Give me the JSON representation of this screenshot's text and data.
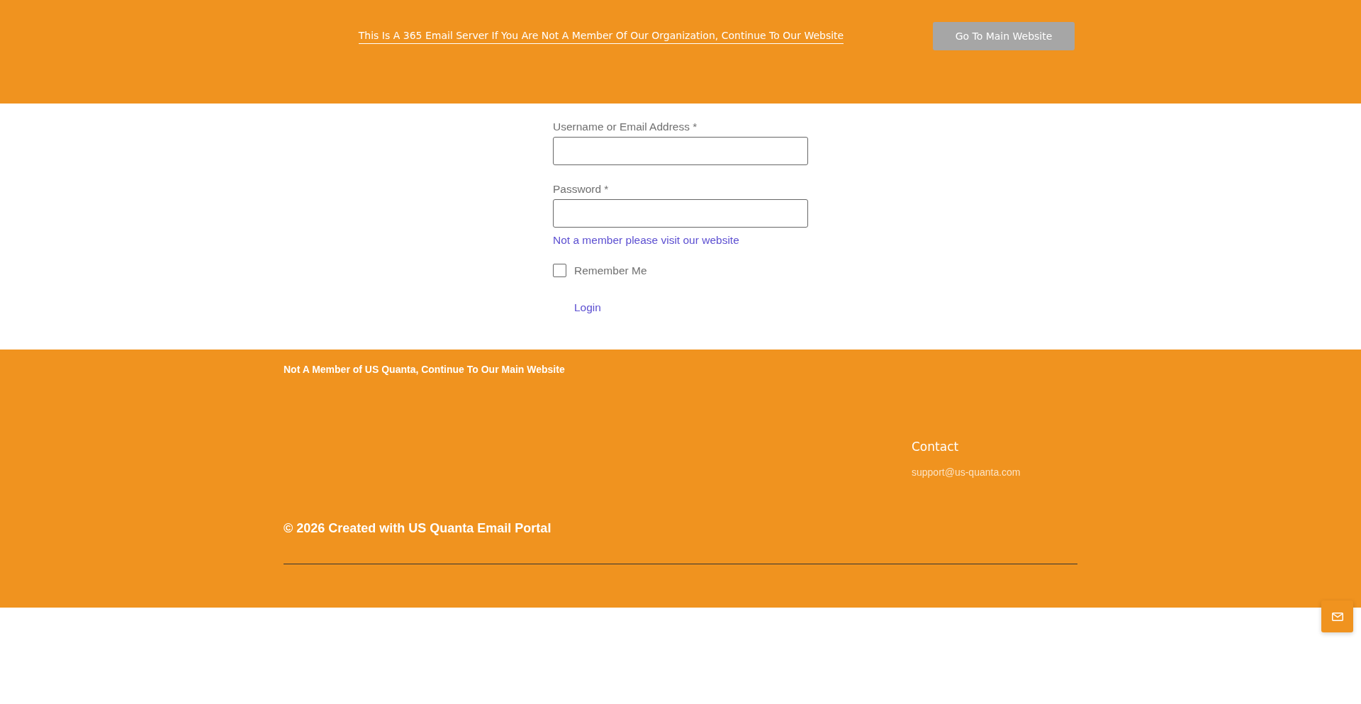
{
  "top_banner": {
    "notice_link": "This Is A 365 Email Server If You Are Not A Member Of Our Organization, Continue To Our Website",
    "button": "Go To Main Website"
  },
  "login_form": {
    "fields": [
      {
        "label": "Username or Email Address *"
      },
      {
        "label": "Password *"
      }
    ],
    "member_link": "Not a member please visit our website",
    "remember_me": {
      "label": "Remember Me",
      "checked": false
    },
    "submit": "Login"
  },
  "footer": {
    "notice": "Not A Member of US Quanta, Continue To Our Main Website",
    "contact": {
      "title": "Contact",
      "email": "support@us-quanta.com"
    },
    "copyright": "© 2026 Created with US Quanta Email Portal"
  }
}
